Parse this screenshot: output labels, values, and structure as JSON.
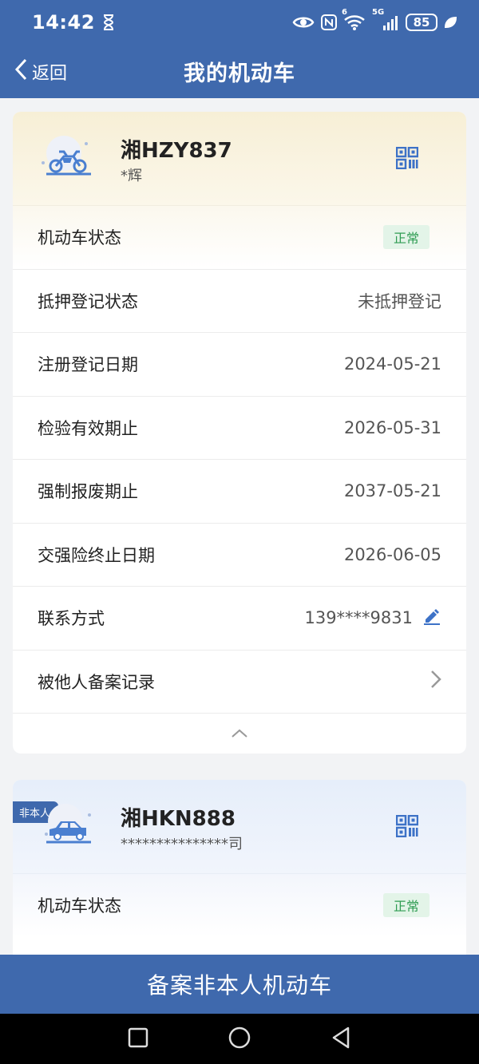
{
  "status_bar": {
    "time": "14:42",
    "battery": "85",
    "network": "5G",
    "sim_indicator": "6"
  },
  "header": {
    "back_label": "返回",
    "title": "我的机动车"
  },
  "vehicles": [
    {
      "plate": "湘HZY837",
      "owner": "*辉",
      "type_icon": "motorcycle-icon",
      "rows": [
        {
          "label": "机动车状态",
          "value": "正常"
        },
        {
          "label": "抵押登记状态",
          "value": "未抵押登记"
        },
        {
          "label": "注册登记日期",
          "value": "2024-05-21"
        },
        {
          "label": "检验有效期止",
          "value": "2026-05-31"
        },
        {
          "label": "强制报废期止",
          "value": "2037-05-21"
        },
        {
          "label": "交强险终止日期",
          "value": "2026-06-05"
        },
        {
          "label": "联系方式",
          "value": "139****9831"
        },
        {
          "label": "被他人备案记录",
          "value": ""
        }
      ]
    },
    {
      "badge": "非本人",
      "plate": "湘HKN888",
      "owner": "***************司",
      "type_icon": "car-icon",
      "rows": [
        {
          "label": "机动车状态",
          "value": "正常"
        }
      ]
    }
  ],
  "bottom_button": {
    "label": "备案非本人机动车"
  },
  "colors": {
    "primary": "#3f69ad",
    "status_ok_bg": "#e3f4e8",
    "status_ok_text": "#2f9c52"
  }
}
